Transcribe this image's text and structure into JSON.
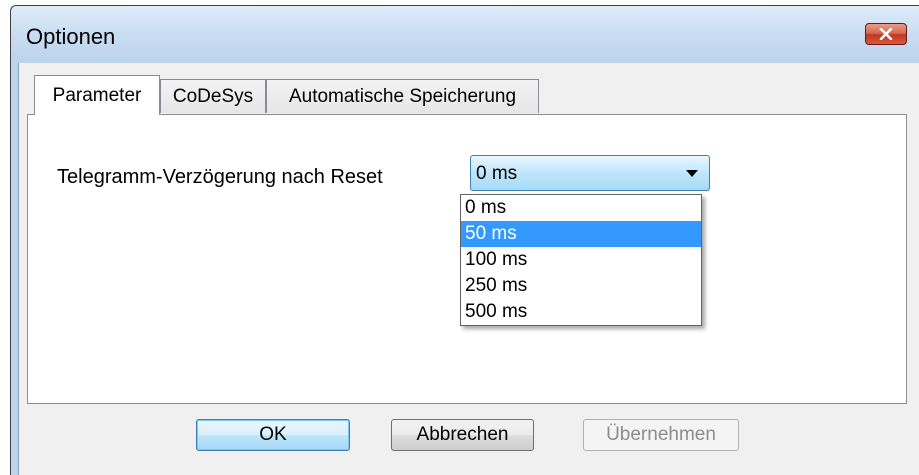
{
  "window": {
    "title": "Optionen",
    "close_icon": "close-icon",
    "accent_color": "#c2371e"
  },
  "tabs": [
    {
      "label": "Parameter",
      "active": true
    },
    {
      "label": "CoDeSys",
      "active": false
    },
    {
      "label": "Automatische Speicherung",
      "active": false
    }
  ],
  "parameter_panel": {
    "field_label": "Telegramm-Verzögerung nach Reset",
    "combo_value": "0 ms",
    "options": [
      "0 ms",
      "50 ms",
      "100 ms",
      "250 ms",
      "500 ms"
    ],
    "highlighted_option": "50 ms",
    "highlight_color": "#3399ff"
  },
  "buttons": {
    "ok": "OK",
    "cancel": "Abbrechen",
    "apply": "Übernehmen"
  }
}
